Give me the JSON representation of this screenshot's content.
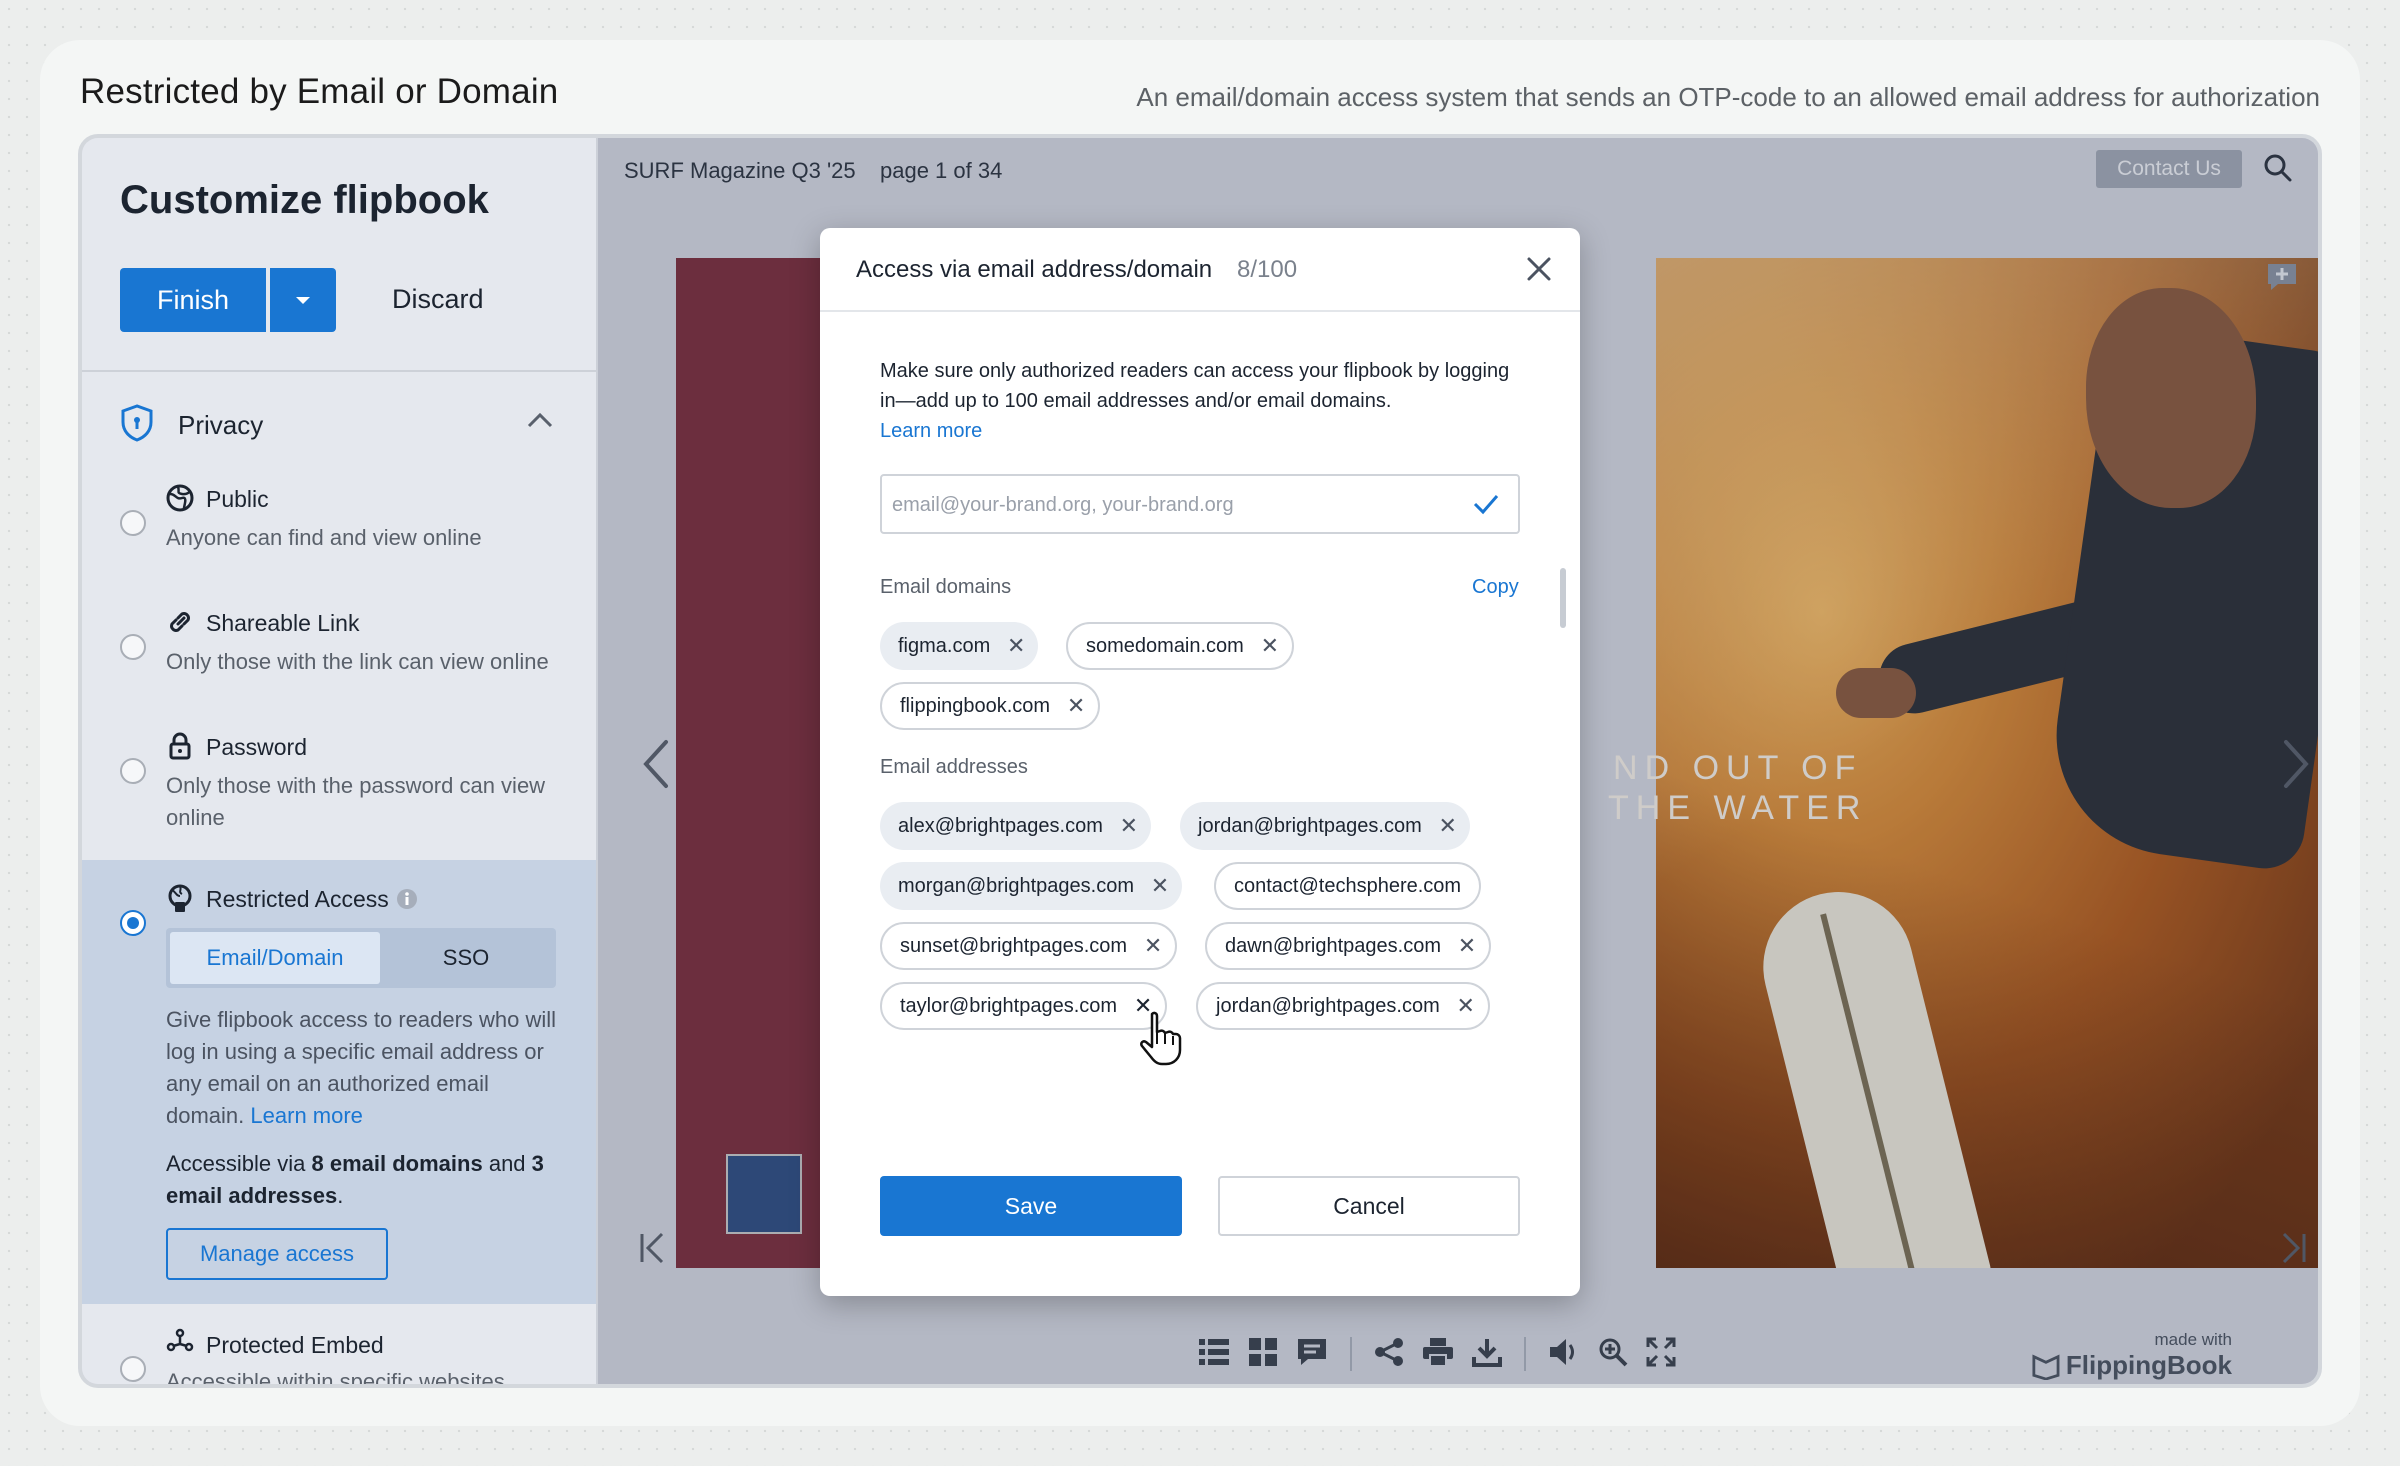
{
  "header": {
    "title": "Restricted by Email or Domain",
    "subtitle": "An email/domain access system that sends an OTP-code to an allowed email address for authorization"
  },
  "sidebar": {
    "title": "Customize flipbook",
    "finish_label": "Finish",
    "discard_label": "Discard",
    "section_label": "Privacy",
    "options": [
      {
        "title": "Public",
        "description": "Anyone can find and view online",
        "icon": "globe-icon"
      },
      {
        "title": "Shareable Link",
        "description": "Only those with the link can view online",
        "icon": "link-icon"
      },
      {
        "title": "Password",
        "description": "Only those with the password can view online",
        "icon": "lock-icon"
      },
      {
        "title": "Restricted Access",
        "icon": "restricted-icon",
        "selected": true
      },
      {
        "title": "Protected Embed",
        "description": "Accessible within specific websites",
        "icon": "embed-icon"
      }
    ],
    "restricted": {
      "tab_email": "Email/Domain",
      "tab_sso": "SSO",
      "description": "Give flipbook access to readers who will log in using a specific email address or any email on an authorized email domain.",
      "learn_more": "Learn more",
      "access_prefix": "Accessible via",
      "access_domains": "8 email domains",
      "access_and": "and",
      "access_addresses": "3 email addresses",
      "access_suffix": ".",
      "manage_label": "Manage access"
    }
  },
  "viewer": {
    "doc_title": "SURF Magazine Q3 '25",
    "page_indicator": "page 1 of 34",
    "contact_label": "Contact Us",
    "magazine_headline_1": "ND OUT OF",
    "magazine_headline_2": "THE WATER",
    "made_with": "made with",
    "brand": "FlippingBook"
  },
  "modal": {
    "title": "Access via email address/domain",
    "count": "8/100",
    "description": "Make sure only authorized readers can access your flipbook by logging in—add up to 100 email addresses and/or email domains.",
    "learn_more": "Learn more",
    "input_placeholder": "email@your-brand.org, your-brand.org",
    "domains_label": "Email domains",
    "copy_label": "Copy",
    "domains": [
      "figma.com",
      "somedomain.com",
      "flippingbook.com"
    ],
    "addresses_label": "Email addresses",
    "addresses": [
      "alex@brightpages.com",
      "jordan@brightpages.com",
      "morgan@brightpages.com",
      "contact@techsphere.com",
      "sunset@brightpages.com",
      "dawn@brightpages.com",
      "taylor@brightpages.com",
      "jordan@brightpages.com"
    ],
    "save_label": "Save",
    "cancel_label": "Cancel"
  },
  "colors": {
    "accent": "#1976d2",
    "restricted_panel": "#c6d2e3"
  }
}
